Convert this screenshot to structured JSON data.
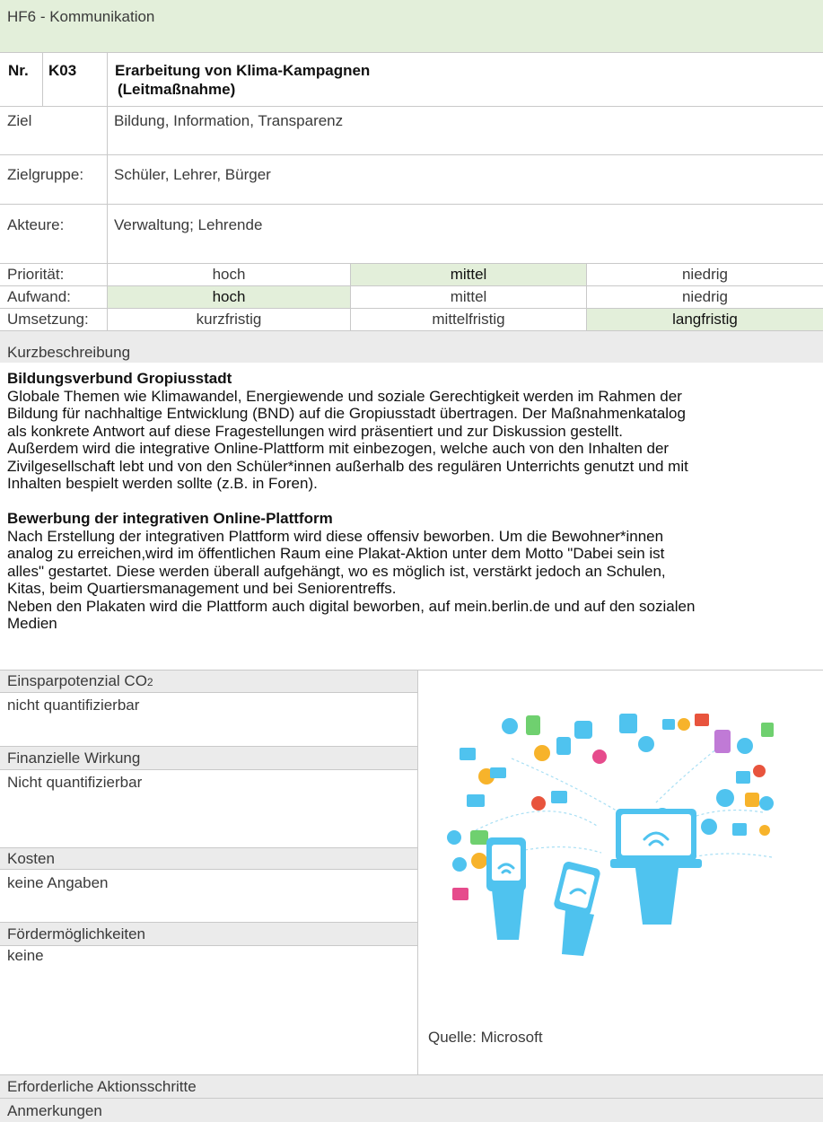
{
  "header": {
    "title": "HF6 - Kommunikation"
  },
  "measure": {
    "nr_label": "Nr.",
    "nr_value": "K03",
    "title_line1": "Erarbeitung von Klima-Kampagnen",
    "title_line2": "(Leitmaßnahme)"
  },
  "fields": {
    "ziel_label": "Ziel",
    "ziel_value": "Bildung, Information, Transparenz",
    "zielgruppe_label": "Zielgruppe:",
    "zielgruppe_value": "Schüler, Lehrer, Bürger",
    "akteure_label": "Akteure:",
    "akteure_value": "Verwaltung; Lehrende"
  },
  "ratings": [
    {
      "label": "Priorität:",
      "options": [
        "hoch",
        "mittel",
        "niedrig"
      ],
      "selected": 1
    },
    {
      "label": "Aufwand:",
      "options": [
        "hoch",
        "mittel",
        "niedrig"
      ],
      "selected": 0
    },
    {
      "label": "Umsetzung:",
      "options": [
        "kurzfristig",
        "mittelfristig",
        "langfristig"
      ],
      "selected": 2
    }
  ],
  "description": {
    "label": "Kurzbeschreibung",
    "section1_heading": "Bildungsverbund Gropiusstadt",
    "section1_lines": [
      "Globale Themen wie Klimawandel, Energiewende und soziale Gerechtigkeit werden im Rahmen der",
      "Bildung für nachhaltige Entwicklung (BND) auf die Gropiusstadt übertragen. Der Maßnahmenkatalog",
      "als konkrete Antwort auf diese Fragestellungen wird präsentiert und zur Diskussion gestellt.",
      "Außerdem wird die integrative Online-Plattform mit einbezogen, welche auch von den Inhalten der",
      "Zivilgesellschaft lebt und von den Schüler*innen außerhalb des regulären Unterrichts genutzt und mit",
      "Inhalten bespielt werden sollte (z.B. in Foren)."
    ],
    "section2_heading": "Bewerbung der integrativen Online-Plattform",
    "section2_lines": [
      "Nach Erstellung der integrativen Plattform wird diese offensiv beworben. Um die Bewohner*innen",
      "analog zu erreichen,wird im öffentlichen Raum eine Plakat-Aktion unter dem Motto \"Dabei sein ist",
      "alles\" gestartet. Diese werden überall aufgehängt, wo es möglich ist, verstärkt jedoch an Schulen,",
      "Kitas, beim Quartiersmanagement und bei Seniorentreffs.",
      "Neben den Plakaten wird die Plattform auch digital beworben, auf mein.berlin.de und auf den sozialen",
      "Medien"
    ]
  },
  "details": {
    "co2_label": "Einsparpotenzial CO",
    "co2_subscript": "2",
    "co2_value": "nicht quantifizierbar",
    "finanz_label": "Finanzielle Wirkung",
    "finanz_value": "Nicht quantifizierbar",
    "kosten_label": "Kosten",
    "kosten_value": "keine Angaben",
    "foerder_label": "Fördermöglichkeiten",
    "foerder_value": "keine",
    "image_caption": "Quelle: Microsoft"
  },
  "footer": {
    "schritte_label": "Erforderliche Aktionsschritte",
    "anmerkungen_label": "Anmerkungen"
  },
  "colors": {
    "highlight": "#e3efda",
    "section_grey": "#ebebeb",
    "grid": "#c9c9c9",
    "illustration_blue": "#4fc3ef"
  }
}
